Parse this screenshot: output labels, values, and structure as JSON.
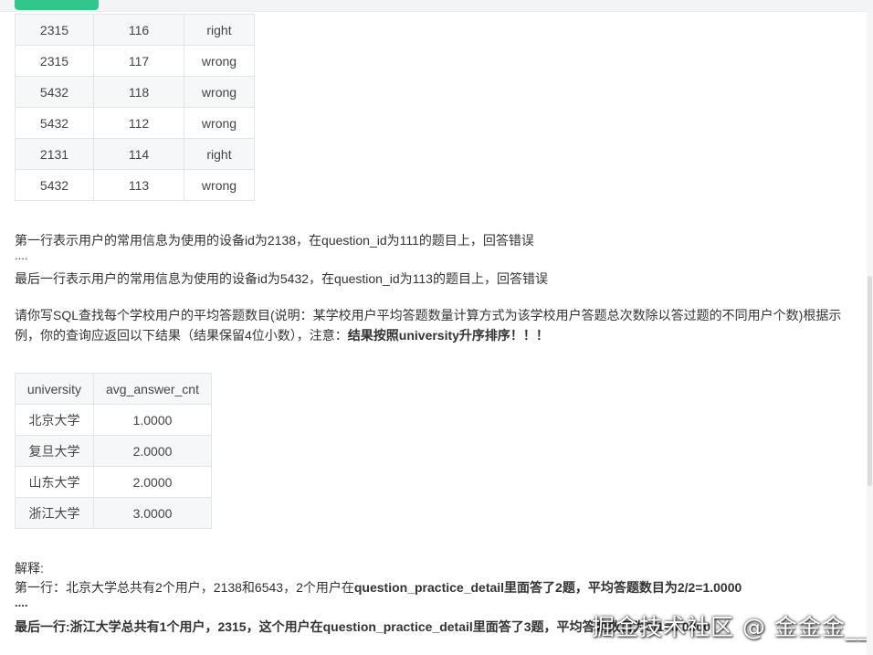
{
  "table1": {
    "rows": [
      [
        "2315",
        "116",
        "right"
      ],
      [
        "2315",
        "117",
        "wrong"
      ],
      [
        "5432",
        "118",
        "wrong"
      ],
      [
        "5432",
        "112",
        "wrong"
      ],
      [
        "2131",
        "114",
        "right"
      ],
      [
        "5432",
        "113",
        "wrong"
      ]
    ]
  },
  "desc": {
    "line1": "第一行表示用户的常用信息为使用的设备id为2138，在question_id为111的题目上，回答错误",
    "ellipsis": "....",
    "line2": "最后一行表示用户的常用信息为使用的设备id为5432，在question_id为113的题目上，回答错误"
  },
  "question": {
    "text": "请你写SQL查找每个学校用户的平均答题数目(说明：某学校用户平均答题数量计算方式为该学校用户答题总次数除以答过题的不同用户个数)根据示例，你的查询应返回以下结果（结果保留4位小数），注意：",
    "emphasis": "结果按照university升序排序！！！"
  },
  "table2": {
    "headers": [
      "university",
      "avg_answer_cnt"
    ],
    "rows": [
      [
        "北京大学",
        "1.0000"
      ],
      [
        "复旦大学",
        "2.0000"
      ],
      [
        "山东大学",
        "2.0000"
      ],
      [
        "浙江大学",
        "3.0000"
      ]
    ]
  },
  "explanation": {
    "title": "解释:",
    "line1_prefix": "第一行：北京大学总共有2个用户，2138和6543，2个用户在",
    "line1_bold": "question_practice_detail里面答了2题，平均答题数目为2/2=1.0000",
    "ellipsis": "....",
    "line2": "最后一行:浙江大学总共有1个用户，2315，这个用户在question_practice_detail里面答了3题，平均答题数目为3/1=3.0000"
  },
  "watermark": "掘金技术社区 @ 金金金__",
  "colors": {
    "accent": "#32c68a",
    "stripe": "#f6f7f9",
    "border": "#e4e4e4"
  }
}
